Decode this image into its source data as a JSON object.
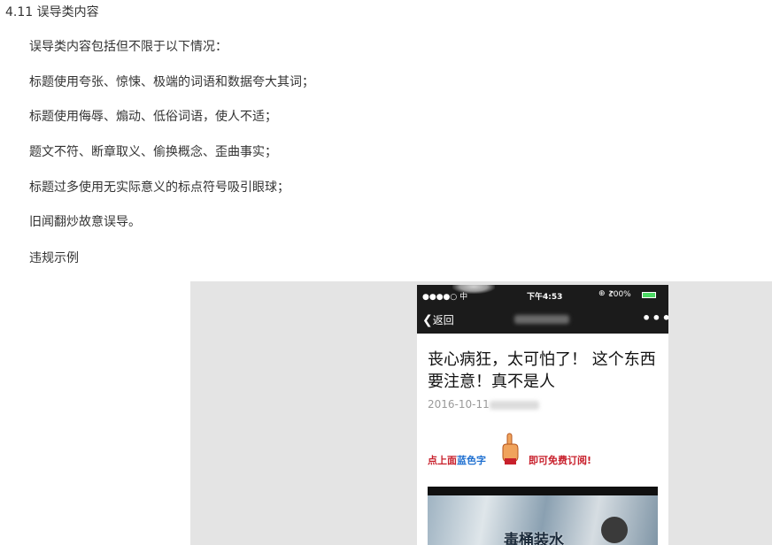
{
  "section": {
    "heading": "4.11 误导类内容",
    "paragraphs": [
      "误导类内容包括但不限于以下情况：",
      "标题使用夸张、惊悚、极端的词语和数据夸大其词；",
      "标题使用侮辱、煽动、低俗词语，使人不适；",
      "题文不符、断章取义、偷换概念、歪曲事实；",
      "标题过多使用无实际意义的标点符号吸引眼球；",
      "旧闻翻炒故意误导。",
      "违规示例"
    ]
  },
  "example": {
    "status_bar": {
      "signal": "●●●●○ 中",
      "time": "下午4:53",
      "battery": "100%",
      "orientation_icon": "orientation-lock-icon",
      "battery_icon": "battery-icon"
    },
    "nav": {
      "back_chevron": "❮",
      "back_label": "返回",
      "more_icon": "•••"
    },
    "article": {
      "title": "丧心病狂，太可怕了！ 这个东西要注意！真不是人",
      "date": "2016-10-11"
    },
    "promo": {
      "part1": "点上面",
      "part2": "蓝色字",
      "part3": "即可免费订阅!",
      "hand_icon": "pointing-hand-icon"
    },
    "image_caption": "毒桶装水",
    "colors": {
      "promo_red": "#c8202c",
      "promo_blue": "#1e6fd0",
      "phone_bar": "#1b1b1b",
      "example_background": "#e4e4e4"
    }
  }
}
